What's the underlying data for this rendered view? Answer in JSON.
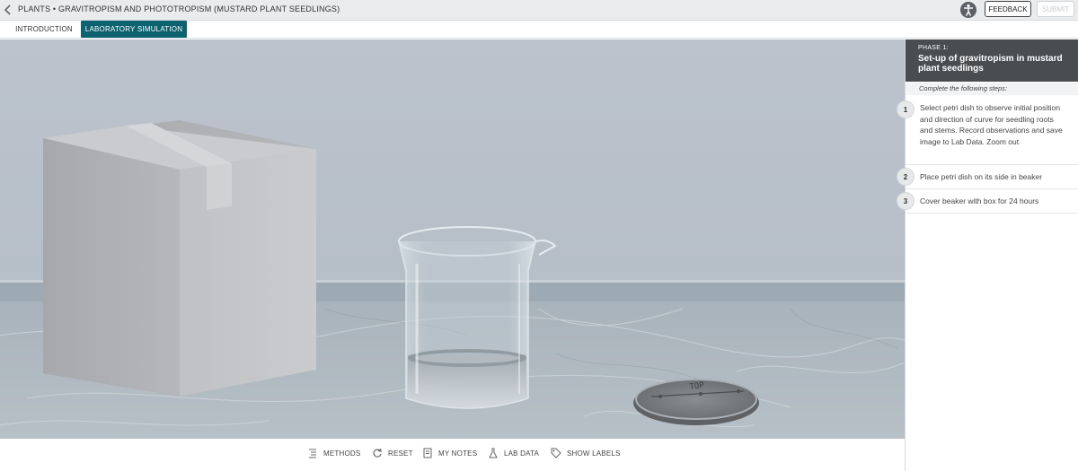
{
  "header": {
    "breadcrumb": "PLANTS • GRAVITROPISM AND PHOTOTROPISM (MUSTARD PLANT SEEDLINGS)",
    "feedback_label": "FEEDBACK",
    "submit_label": "SUBMIT"
  },
  "tabs": [
    {
      "label": "INTRODUCTION",
      "active": false
    },
    {
      "label": "LABORATORY SIMULATION",
      "active": true
    }
  ],
  "scene": {
    "petri_label": "TOP"
  },
  "toolbar": [
    {
      "label": "METHODS",
      "icon": "methods-icon"
    },
    {
      "label": "RESET",
      "icon": "reset-icon"
    },
    {
      "label": "MY NOTES",
      "icon": "notes-icon"
    },
    {
      "label": "LAB DATA",
      "icon": "flask-icon"
    },
    {
      "label": "SHOW LABELS",
      "icon": "tag-icon"
    }
  ],
  "panel": {
    "phase_label": "PHASE 1:",
    "phase_title": "Set-up of gravitropism in mustard plant seedlings",
    "instructions": "Complete the following steps:",
    "steps": [
      {
        "num": "1",
        "text": "Select petri dish to observe initial position and direction of curve for seedling roots and stems. Record observations and save image to Lab Data. Zoom out"
      },
      {
        "num": "2",
        "text": "Place petri dish on its side in beaker"
      },
      {
        "num": "3",
        "text": "Cover beaker with box for 24 hours"
      }
    ]
  },
  "colors": {
    "accent": "#0d6270",
    "phase_header": "#4a4d50",
    "wall": "#b4bcc6",
    "counter": "#aab4bc"
  }
}
